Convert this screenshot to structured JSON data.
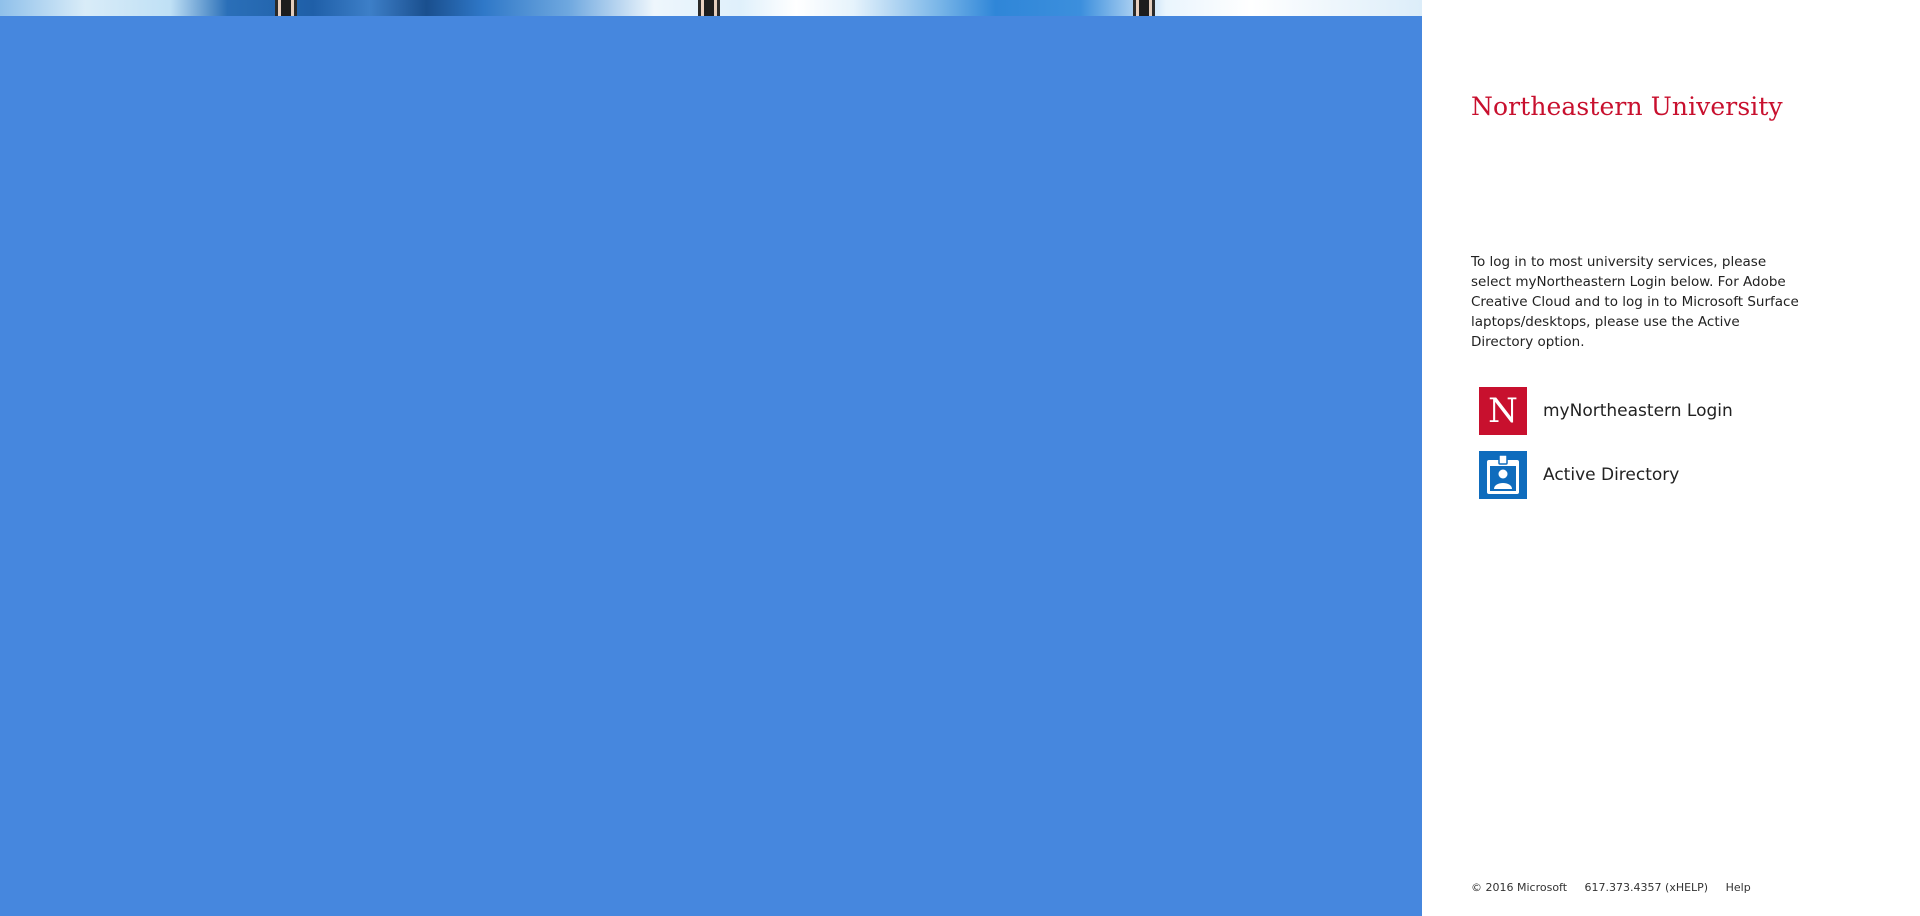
{
  "brand": {
    "logo_text": "Northeastern University",
    "logo_color": "#c8102e",
    "background_color": "#4687de"
  },
  "intro": {
    "text": "To log in to most university services, please select myNortheastern Login below. For Adobe Creative Cloud and to log in to Microsoft Surface laptops/desktops, please use the Active Directory option."
  },
  "providers": [
    {
      "label": "myNortheastern Login",
      "icon": "northeastern-n-icon",
      "tile_letter": "N",
      "tile_color": "#c8102e"
    },
    {
      "label": "Active Directory",
      "icon": "id-badge-icon",
      "tile_color": "#0f6cbd"
    }
  ],
  "footer": {
    "copyright": "© 2016 Microsoft",
    "phone": "617.373.4357 (xHELP)",
    "help": "Help"
  }
}
